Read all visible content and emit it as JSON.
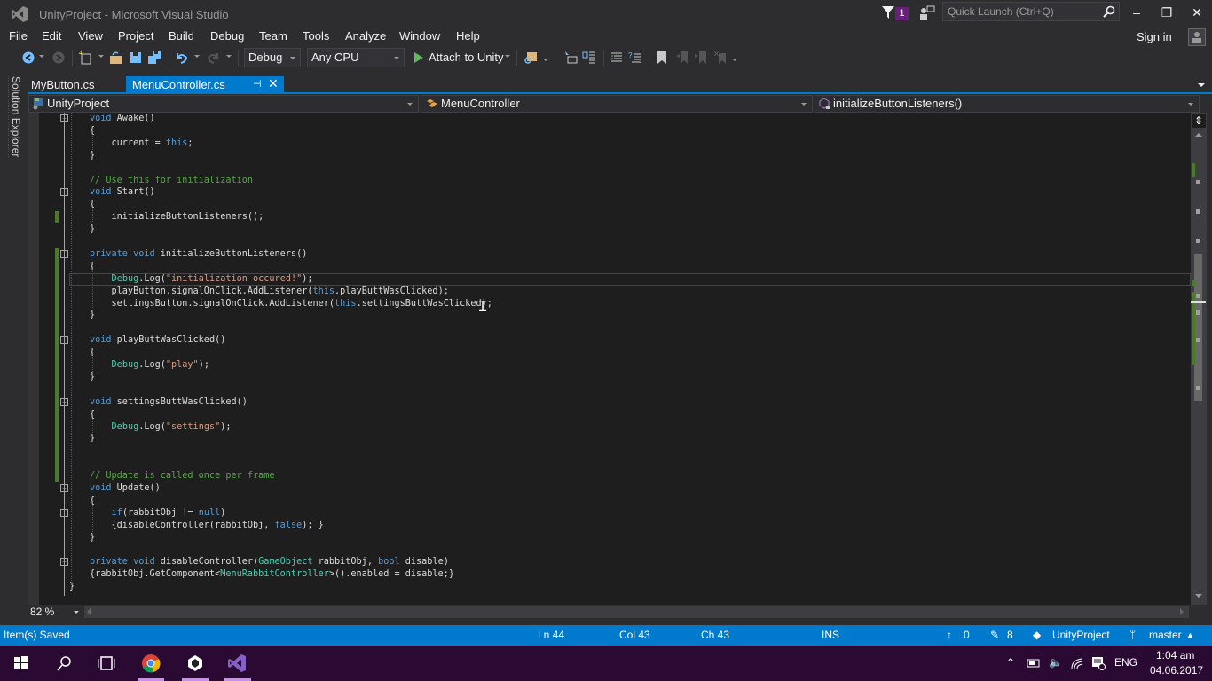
{
  "window": {
    "title": "UnityProject - Microsoft Visual Studio",
    "notification_count": "1",
    "quick_launch_placeholder": "Quick Launch (Ctrl+Q)",
    "minimize": "‒",
    "restore": "❐",
    "close": "✕"
  },
  "menu": {
    "items": [
      "File",
      "Edit",
      "View",
      "Project",
      "Build",
      "Debug",
      "Team",
      "Tools",
      "Analyze",
      "Window",
      "Help"
    ],
    "sign_in": "Sign in"
  },
  "toolbar": {
    "configuration": "Debug",
    "platform": "Any CPU",
    "attach_label": "Attach to Unity"
  },
  "side_panel": {
    "solution_explorer": "Solution Explorer"
  },
  "tabs": [
    {
      "label": "MyButton.cs",
      "active": false
    },
    {
      "label": "MenuController.cs",
      "active": true
    }
  ],
  "tab_icons": {
    "pin": "⊣",
    "close": "✕"
  },
  "navbar": {
    "project": "UnityProject",
    "class": "MenuController",
    "member": "initializeButtonListeners()"
  },
  "code": {
    "lines": [
      [
        {
          "t": "void ",
          "c": "kw"
        },
        {
          "t": "Awake()",
          "c": ""
        }
      ],
      [
        {
          "t": "{",
          "c": ""
        }
      ],
      [
        {
          "t": "    current = ",
          "c": ""
        },
        {
          "t": "this",
          "c": "kw"
        },
        {
          "t": ";",
          "c": ""
        }
      ],
      [
        {
          "t": "}",
          "c": ""
        }
      ],
      [],
      [
        {
          "t": "// Use this for initialization",
          "c": "cm"
        }
      ],
      [
        {
          "t": "void ",
          "c": "kw"
        },
        {
          "t": "Start()",
          "c": ""
        }
      ],
      [
        {
          "t": "{",
          "c": ""
        }
      ],
      [
        {
          "t": "    initializeButtonListeners();",
          "c": ""
        }
      ],
      [
        {
          "t": "}",
          "c": ""
        }
      ],
      [],
      [
        {
          "t": "private void ",
          "c": "kw"
        },
        {
          "t": "initializeButtonListeners()",
          "c": ""
        }
      ],
      [
        {
          "t": "{",
          "c": ""
        }
      ],
      [
        {
          "t": "    ",
          "c": ""
        },
        {
          "t": "Debug",
          "c": "ty"
        },
        {
          "t": ".Log(",
          "c": ""
        },
        {
          "t": "\"initialization occured!\"",
          "c": "st"
        },
        {
          "t": ");",
          "c": ""
        }
      ],
      [
        {
          "t": "    playButton.signalOnClick.AddListener(",
          "c": ""
        },
        {
          "t": "this",
          "c": "kw"
        },
        {
          "t": ".playButtWasClicked);",
          "c": ""
        }
      ],
      [
        {
          "t": "    settingsButton.signalOnClick.AddListener(",
          "c": ""
        },
        {
          "t": "this",
          "c": "kw"
        },
        {
          "t": ".settingsButtWasClicked);",
          "c": ""
        }
      ],
      [
        {
          "t": "}",
          "c": ""
        }
      ],
      [],
      [
        {
          "t": "void ",
          "c": "kw"
        },
        {
          "t": "playButtWasClicked()",
          "c": ""
        }
      ],
      [
        {
          "t": "{",
          "c": ""
        }
      ],
      [
        {
          "t": "    ",
          "c": ""
        },
        {
          "t": "Debug",
          "c": "ty"
        },
        {
          "t": ".Log(",
          "c": ""
        },
        {
          "t": "\"play\"",
          "c": "st"
        },
        {
          "t": ");",
          "c": ""
        }
      ],
      [
        {
          "t": "}",
          "c": ""
        }
      ],
      [],
      [
        {
          "t": "void ",
          "c": "kw"
        },
        {
          "t": "settingsButtWasClicked()",
          "c": ""
        }
      ],
      [
        {
          "t": "{",
          "c": ""
        }
      ],
      [
        {
          "t": "    ",
          "c": ""
        },
        {
          "t": "Debug",
          "c": "ty"
        },
        {
          "t": ".Log(",
          "c": ""
        },
        {
          "t": "\"settings\"",
          "c": "st"
        },
        {
          "t": ");",
          "c": ""
        }
      ],
      [
        {
          "t": "}",
          "c": ""
        }
      ],
      [],
      [],
      [
        {
          "t": "// Update is called once per frame",
          "c": "cm"
        }
      ],
      [
        {
          "t": "void ",
          "c": "kw"
        },
        {
          "t": "Update()",
          "c": ""
        }
      ],
      [
        {
          "t": "{",
          "c": ""
        }
      ],
      [
        {
          "t": "    ",
          "c": ""
        },
        {
          "t": "if",
          "c": "kw"
        },
        {
          "t": "(rabbitObj != ",
          "c": ""
        },
        {
          "t": "null",
          "c": "kw"
        },
        {
          "t": ")",
          "c": ""
        }
      ],
      [
        {
          "t": "    {disableController(rabbitObj, ",
          "c": ""
        },
        {
          "t": "false",
          "c": "kw"
        },
        {
          "t": "); }",
          "c": ""
        }
      ],
      [
        {
          "t": "}",
          "c": ""
        }
      ],
      [],
      [
        {
          "t": "private void ",
          "c": "kw"
        },
        {
          "t": "disableController(",
          "c": ""
        },
        {
          "t": "GameObject",
          "c": "ty"
        },
        {
          "t": " rabbitObj, ",
          "c": ""
        },
        {
          "t": "bool",
          "c": "kw"
        },
        {
          "t": " disable)",
          "c": ""
        }
      ],
      [
        {
          "t": "{rabbitObj.GetComponent<",
          "c": ""
        },
        {
          "t": "MenuRabbitController",
          "c": "ty"
        },
        {
          "t": ">().enabled = disable;}",
          "c": ""
        }
      ],
      [
        {
          "t": "}",
          "c": "",
          "outdent": true
        }
      ]
    ]
  },
  "editor": {
    "zoom_level": "82 %"
  },
  "status": {
    "message": "Item(s) Saved",
    "line": "Ln 44",
    "col": "Col 43",
    "ch": "Ch 43",
    "mode": "INS",
    "unpublished": "0",
    "pending_changes": "8",
    "repo": "UnityProject",
    "branch": "master"
  },
  "taskbar": {
    "language": "ENG",
    "time": "1:04 am",
    "date": "04.06.2017"
  }
}
